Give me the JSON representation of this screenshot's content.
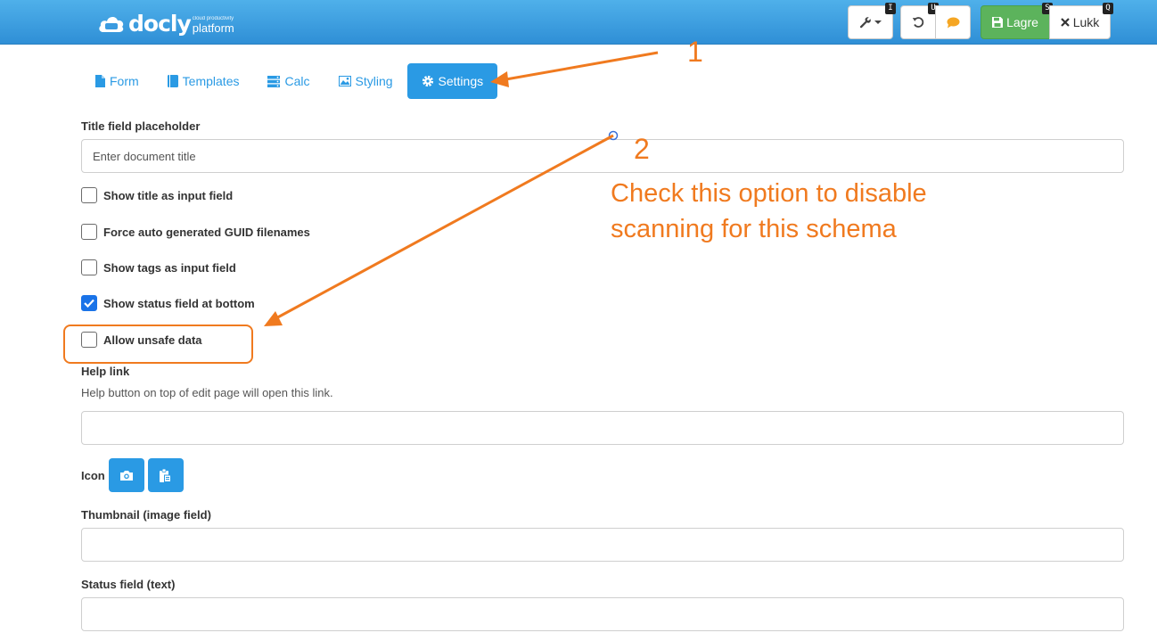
{
  "header": {
    "brand": "docly",
    "brand_small": "cloud productivity",
    "brand_sub": "platform",
    "buttons": {
      "tools_key": "I",
      "undo_key": "U",
      "save_label": "Lagre",
      "save_key": "S",
      "close_label": "Lukk",
      "close_key": "Q"
    }
  },
  "tabs": [
    {
      "label": "Form",
      "icon": "file-icon"
    },
    {
      "label": "Templates",
      "icon": "book-icon"
    },
    {
      "label": "Calc",
      "icon": "server-icon"
    },
    {
      "label": "Styling",
      "icon": "image-icon"
    },
    {
      "label": "Settings",
      "icon": "gear-icon",
      "active": true
    }
  ],
  "form": {
    "title_placeholder_label": "Title field placeholder",
    "title_placeholder_value": "Enter document title",
    "checkboxes": [
      {
        "label": "Show title as input field",
        "checked": false
      },
      {
        "label": "Force auto generated GUID filenames",
        "checked": false
      },
      {
        "label": "Show tags as input field",
        "checked": false
      },
      {
        "label": "Show status field at bottom",
        "checked": true
      },
      {
        "label": "Allow unsafe data",
        "checked": false
      }
    ],
    "help_link_label": "Help link",
    "help_link_hint": "Help button on top of edit page will open this link.",
    "help_link_value": "",
    "icon_label": "Icon",
    "thumbnail_label": "Thumbnail (image field)",
    "thumbnail_value": "",
    "status_field_label": "Status field (text)",
    "status_field_value": ""
  },
  "annotations": {
    "step1": "1",
    "step2": "2",
    "note": "Check this option to disable scanning for this schema",
    "color": "#f07a1f"
  },
  "colors": {
    "header": "#3a9be0",
    "accent": "#2a9ae4",
    "save": "#5cb35c"
  }
}
